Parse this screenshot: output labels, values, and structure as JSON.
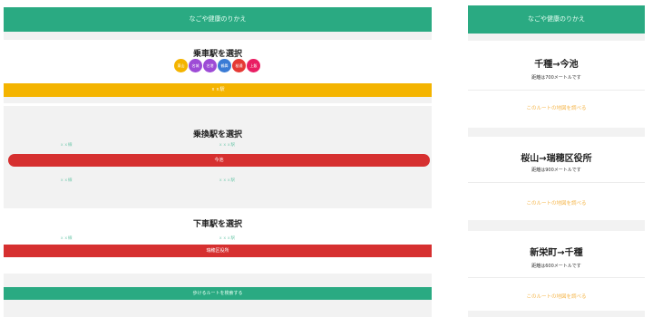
{
  "left_app": {
    "title": "なごや健康のりかえ",
    "boarding": {
      "heading": "乗車駅を選択",
      "lines": [
        {
          "label": "東山",
          "color": "#f4b400"
        },
        {
          "label": "名城",
          "color": "#9d4bd6"
        },
        {
          "label": "名港",
          "color": "#9d4bd6"
        },
        {
          "label": "鶴舞",
          "color": "#3a7bd5"
        },
        {
          "label": "桜通",
          "color": "#e53935"
        },
        {
          "label": "上飯",
          "color": "#e91e63"
        }
      ],
      "selected_station": "ｘｘ駅"
    },
    "transfer": {
      "heading": "乗換駅を選択",
      "option_a1": "ｘｘ線",
      "option_b1": "ｘｘｘ駅",
      "selected_station": "今池",
      "option_a2": "ｘｘ線",
      "option_b2": "ｘｘｘ駅"
    },
    "alighting": {
      "heading": "下車駅を選択",
      "option_a": "ｘｘ線",
      "option_b": "ｘｘｘ駅",
      "selected_station": "瑞穂区役所"
    },
    "search_button": "歩けるルートを検索する"
  },
  "right_app": {
    "title": "なごや健康のりかえ",
    "routes": [
      {
        "title": "千種→今池",
        "distance": "距離は700メートルです",
        "link": "このルートの地図を調べる"
      },
      {
        "title": "桜山→瑞穂区役所",
        "distance": "距離は900メートルです",
        "link": "このルートの地図を調べる"
      },
      {
        "title": "新栄町→千種",
        "distance": "距離は600メートルです",
        "link": "このルートの地図を調べる"
      }
    ]
  },
  "colors": {
    "brand_green": "#2aaa82",
    "yellow": "#f4b400",
    "red": "#d63030",
    "link_orange": "#f5b74e"
  }
}
